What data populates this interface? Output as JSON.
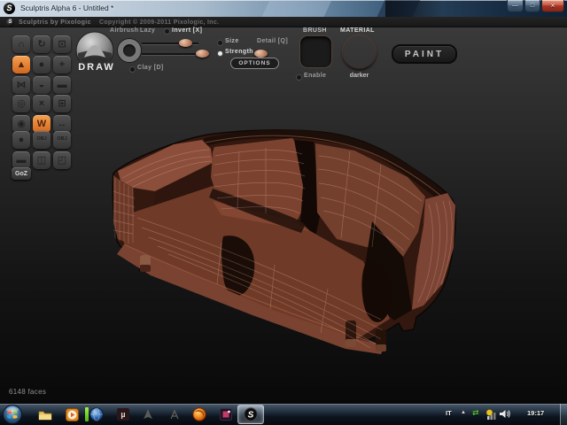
{
  "window": {
    "title": "Sculptris Alpha 6 - Untitled *",
    "logo_glyph": "S",
    "minimize_glyph": "—",
    "maximize_glyph": "□",
    "close_glyph": "×"
  },
  "header": {
    "brand": "Sculptris by Pixologic",
    "copyright": "Copyright © 2009-2011 Pixologic, Inc."
  },
  "toolbar": {
    "brush_name": "DRAW",
    "airbrush_label": "Airbrush",
    "lazy_label": "Lazy",
    "invert_label": "Invert [X]",
    "size_label": "Size",
    "detail_label": "Detail [Q]",
    "strength_label": "Strength",
    "clay_label": "Clay [D]",
    "options_label": "OPTIONS",
    "brush_section_label": "BRUSH",
    "enable_label": "Enable",
    "material_section_label": "MATERIAL",
    "material_mode_label": "darker",
    "paint_label": "PAINT"
  },
  "tool_palette": {
    "goz_label": "GoZ",
    "groups": [
      {
        "items": [
          {
            "name": "crease-tool",
            "glyph": "∩"
          },
          {
            "name": "rotate-tool",
            "glyph": "↻"
          },
          {
            "name": "scale-tool",
            "glyph": "⊡"
          },
          {
            "name": "draw-tool",
            "glyph": "▲",
            "active": true
          },
          {
            "name": "inflate-tool",
            "glyph": "●"
          },
          {
            "name": "grab-tool",
            "glyph": "+"
          },
          {
            "name": "pinch-tool",
            "glyph": "⋈"
          },
          {
            "name": "smooth-tool",
            "glyph": "◒"
          },
          {
            "name": "flatten-tool",
            "glyph": "▬"
          }
        ]
      },
      {
        "items": [
          {
            "name": "reduce-brush-tool",
            "glyph": "◎"
          },
          {
            "name": "reduce-selected-tool",
            "glyph": "×"
          },
          {
            "name": "subdivide-all-tool",
            "glyph": "⊞"
          },
          {
            "name": "mask-tool",
            "glyph": "◉"
          },
          {
            "name": "wireframe-toggle",
            "glyph": "W",
            "active": true
          },
          {
            "name": "symmetry-toggle",
            "glyph": "↔"
          }
        ]
      },
      {
        "items": [
          {
            "name": "new-sphere-button",
            "glyph": "●"
          },
          {
            "name": "import-obj-button",
            "glyph": "OBJ"
          },
          {
            "name": "export-obj-button",
            "glyph": "OBJ"
          },
          {
            "name": "new-plane-button",
            "glyph": "▬"
          },
          {
            "name": "open-button",
            "glyph": "◫"
          },
          {
            "name": "save-button",
            "glyph": "◰"
          }
        ]
      }
    ]
  },
  "viewport": {
    "status": "6148 faces"
  },
  "taskbar": {
    "utorrent_glyph": "µ",
    "sculptris_glyph": "S",
    "tray": {
      "language": "IT",
      "hidden_icons_glyph": "▲",
      "time": "19:17"
    }
  },
  "colors": {
    "accent_orange": "#e2863a",
    "material_brown": "#a65138",
    "wireframe_pink": "#f0b9a0",
    "close_red": "#c23b2a",
    "taskbar_active_glass": "#b9c6d2",
    "canvas_top": "#3a3a3a",
    "canvas_bottom": "#090909"
  }
}
